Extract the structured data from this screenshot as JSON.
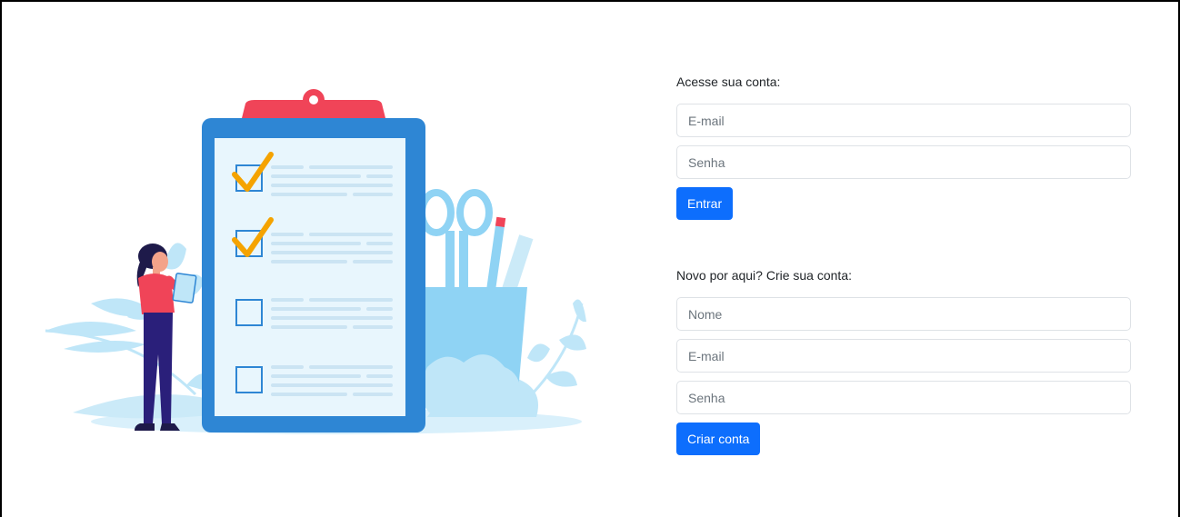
{
  "login": {
    "title": "Acesse sua conta:",
    "email_placeholder": "E-mail",
    "password_placeholder": "Senha",
    "submit_label": "Entrar"
  },
  "signup": {
    "title": "Novo por aqui? Crie sua conta:",
    "name_placeholder": "Nome",
    "email_placeholder": "E-mail",
    "password_placeholder": "Senha",
    "submit_label": "Criar conta"
  },
  "colors": {
    "primary": "#0d6efd",
    "clipboard_frame": "#2e86d4",
    "clipboard_clip": "#f04458",
    "check": "#f5a300",
    "decor_light_blue": "#bfe6f8"
  },
  "icons": {
    "illustration": "checklist-clipboard-illustration"
  }
}
